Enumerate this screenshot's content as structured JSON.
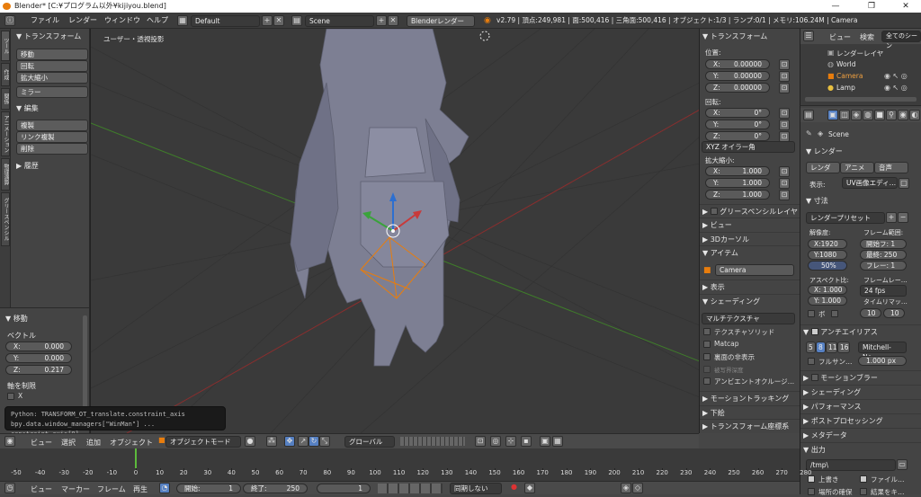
{
  "window": {
    "title": "Blender* [C:¥プログラム以外¥kijiyou.blend]",
    "minimize": "—",
    "maximize": "❐",
    "close": "✕"
  },
  "menu": {
    "items": [
      "ファイル",
      "レンダー",
      "ウィンドウ",
      "ヘルプ"
    ],
    "layout": "Default",
    "scene": "Scene",
    "engine": "Blenderレンダー",
    "stats": "v2.79 | 頂点:249,981 | 面:500,416 | 三角面:500,416 | オブジェクト:1/3 | ランプ:0/1 | メモリ:106.24M | Camera"
  },
  "vtabs": [
    "ツール",
    "作成",
    "関係",
    "アニメーション",
    "物理演算",
    "グリースペンシル"
  ],
  "tool": {
    "transform_header": "▼ トランスフォーム",
    "transform_buttons": [
      "移動",
      "回転",
      "拡大縮小",
      "ミラー"
    ],
    "edit_header": "▼ 編集",
    "edit_buttons": [
      "複製",
      "リンク複製",
      "削除"
    ],
    "history_header": "▶ 履歴"
  },
  "redo": {
    "header": "▼ 移動",
    "vector_label": "ベクトル",
    "x_label": "X:",
    "x": "0.000",
    "y_label": "Y:",
    "y": "0.000",
    "z_label": "Z:",
    "z": "0.217",
    "constraint_label": "軸を制限",
    "cx": "X"
  },
  "tooltip": {
    "line1": "Python: TRANSFORM_OT_translate.constraint_axis",
    "line2": "bpy.data.window_managers[\"WinMan\"] ... constraint_axis[0]"
  },
  "viewport": {
    "label": "ユーザー・透視投影"
  },
  "npanel": {
    "transform": "▼ トランスフォーム",
    "location": "位置:",
    "lx": "X:",
    "lxv": "0.00000",
    "ly": "Y:",
    "lyv": "0.00000",
    "lz": "Z:",
    "lzv": "0.00000",
    "rotation": "回転:",
    "rx": "X:",
    "rxv": "0°",
    "ry": "Y:",
    "ryv": "0°",
    "rz": "Z:",
    "rzv": "0°",
    "rot_mode": "XYZ オイラー角",
    "scale": "拡大縮小:",
    "sx": "X:",
    "sxv": "1.000",
    "sy": "Y:",
    "syv": "1.000",
    "sz": "Z:",
    "szv": "1.000",
    "grease": "グリースペンシルレイヤ",
    "view": "▶ ビュー",
    "cursor": "▶ 3Dカーソル",
    "item": "▼ アイテム",
    "item_name": "Camera",
    "display": "▶ 表示",
    "shading": "▼ シェーディング",
    "shading_mode": "マルチテクスチャ",
    "opts": [
      "テクスチャソリッド",
      "Matcap",
      "裏面の非表示",
      "被写界深度",
      "アンビエントオクルージ…"
    ],
    "motion_tracking": "モーショントラッキング",
    "background": "下絵",
    "transform_orient": "▶ トランスフォーム座標系"
  },
  "outliner": {
    "view": "ビュー",
    "search": "検索",
    "filter": "全てのシーン",
    "items": [
      "レンダーレイヤ",
      "World",
      "Camera",
      "Lamp"
    ]
  },
  "props": {
    "scene": "Scene",
    "render": "▼ レンダー",
    "render_btn": "レンダ",
    "anim_btn": "アニメ",
    "audio_btn": "音声",
    "display_label": "表示:",
    "display_val": "UV画像エディ…",
    "dims": "▼ 寸法",
    "preset": "レンダープリセット",
    "resolution": "解像度:",
    "frame_range": "フレーム範囲:",
    "resx": "X:1920 px",
    "resy": "Y:1080 px",
    "pct": "50%",
    "start": "開始フ: 1",
    "end": "最終: 250",
    "step": "フレー: 1",
    "aspect": "アスペクト比:",
    "framerate": "フレームレー…",
    "ax": "X: 1.000",
    "ay": "Y: 1.000",
    "fps": "24 fps",
    "remap": "タイムリマッ…",
    "b": "ボ",
    "r10a": "10",
    "r10b": "10",
    "aa": "アンチエイリアス",
    "aa_nums": [
      "5",
      "8",
      "11",
      "16"
    ],
    "aa_filter": "Mitchell-Ne…",
    "full_sample": "フルサン…",
    "aa_size": "1.000 px",
    "motion_blur": "モーションブラー",
    "shading": "▶ シェーディング",
    "performance": "▶ パフォーマンス",
    "post": "▶ ポストプロセッシング",
    "meta": "▶ メタデータ",
    "output": "▼ 出力",
    "path": "/tmp\\",
    "overwrite": "上書き",
    "file_ext": "ファイル…",
    "placeholder": "場所の確保",
    "cache": "結果をキ…"
  },
  "vhead": {
    "view": "ビュー",
    "select": "選択",
    "add": "追加",
    "object": "オブジェクト",
    "mode": "オブジェクトモード",
    "orient": "グローバル"
  },
  "timeline": {
    "ticks": [
      "-50",
      "-40",
      "-30",
      "-20",
      "-10",
      "0",
      "10",
      "20",
      "30",
      "40",
      "50",
      "60",
      "70",
      "80",
      "90",
      "100",
      "110",
      "120",
      "130",
      "140",
      "150",
      "160",
      "170",
      "180",
      "190",
      "200",
      "210",
      "220",
      "230",
      "240",
      "250",
      "260",
      "270",
      "280"
    ],
    "view": "ビュー",
    "marker": "マーカー",
    "frame": "フレーム",
    "play": "再生",
    "start_label": "開始:",
    "start": "1",
    "end_label": "終了:",
    "end": "250",
    "current": "1",
    "sync": "同期しない"
  },
  "colors": {
    "accent": "#e87d0d",
    "select": "#5680c2"
  }
}
